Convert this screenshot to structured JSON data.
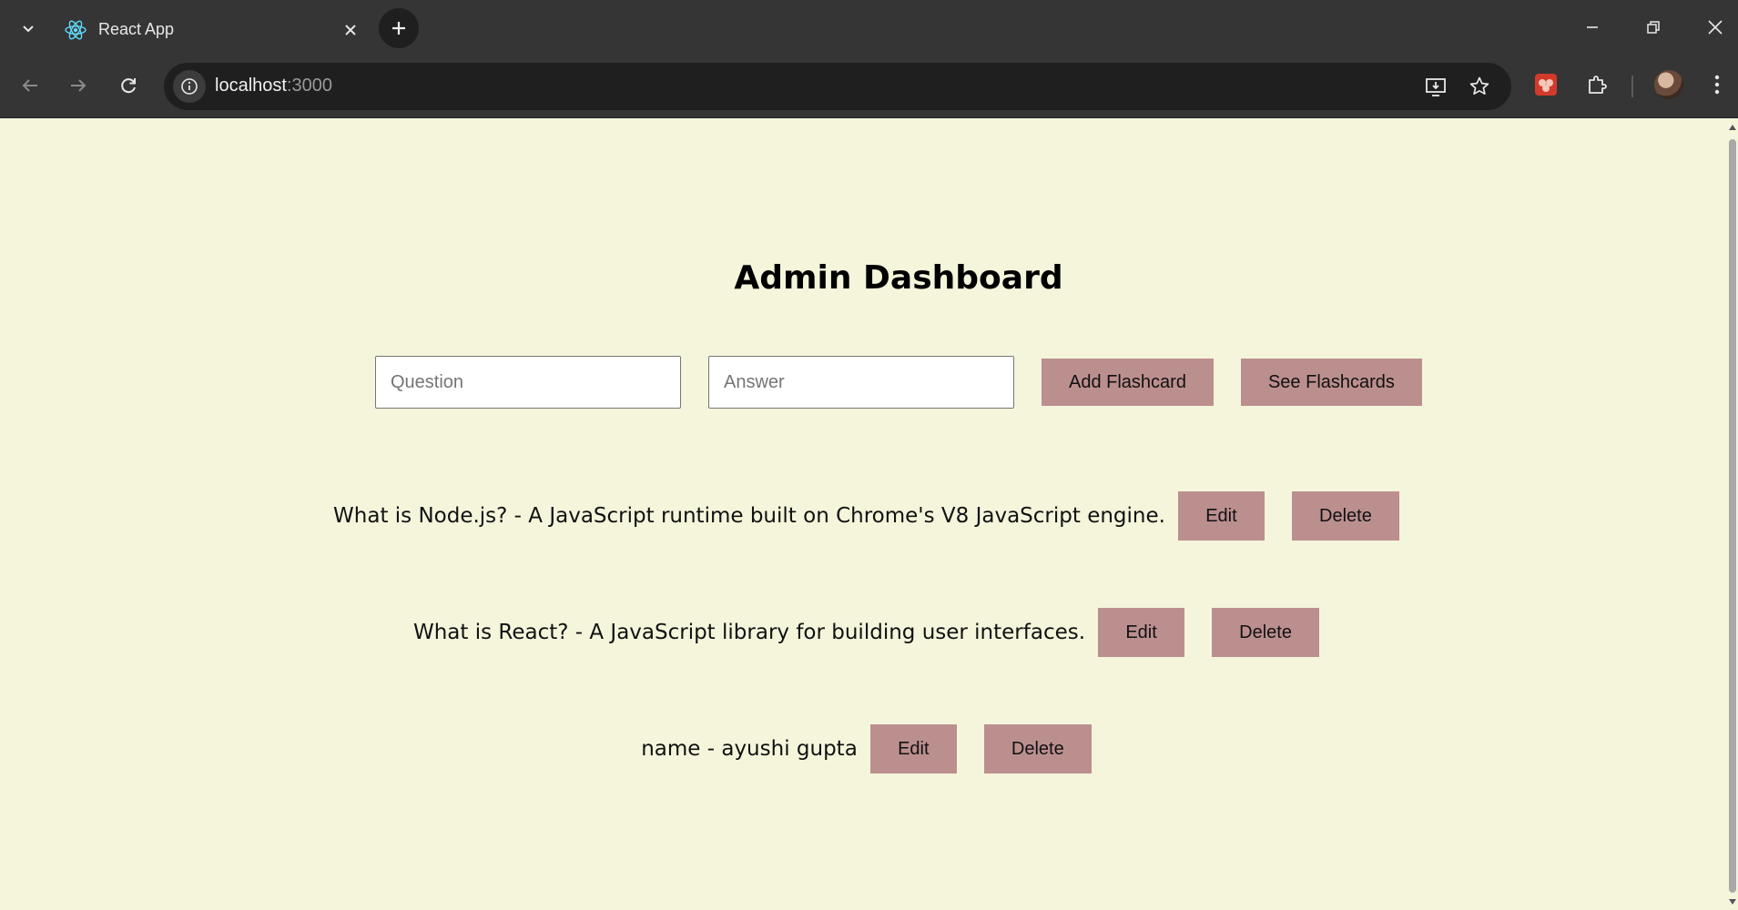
{
  "browser": {
    "tab_title": "React App",
    "url_host": "localhost",
    "url_port": ":3000"
  },
  "page": {
    "title": "Admin Dashboard",
    "question_placeholder": "Question",
    "answer_placeholder": "Answer",
    "add_button": "Add Flashcard",
    "see_button": "See Flashcards"
  },
  "flashcards": [
    {
      "text": "What is Node.js? - A JavaScript runtime built on Chrome's V8 JavaScript engine.",
      "edit": "Edit",
      "delete": "Delete"
    },
    {
      "text": "What is React? - A JavaScript library for building user interfaces.",
      "edit": "Edit",
      "delete": "Delete"
    },
    {
      "text": "name - ayushi gupta",
      "edit": "Edit",
      "delete": "Delete"
    }
  ],
  "colors": {
    "page_background": "#f5f5dc",
    "button_background": "#bc8f8f",
    "chrome_background": "#353535"
  }
}
